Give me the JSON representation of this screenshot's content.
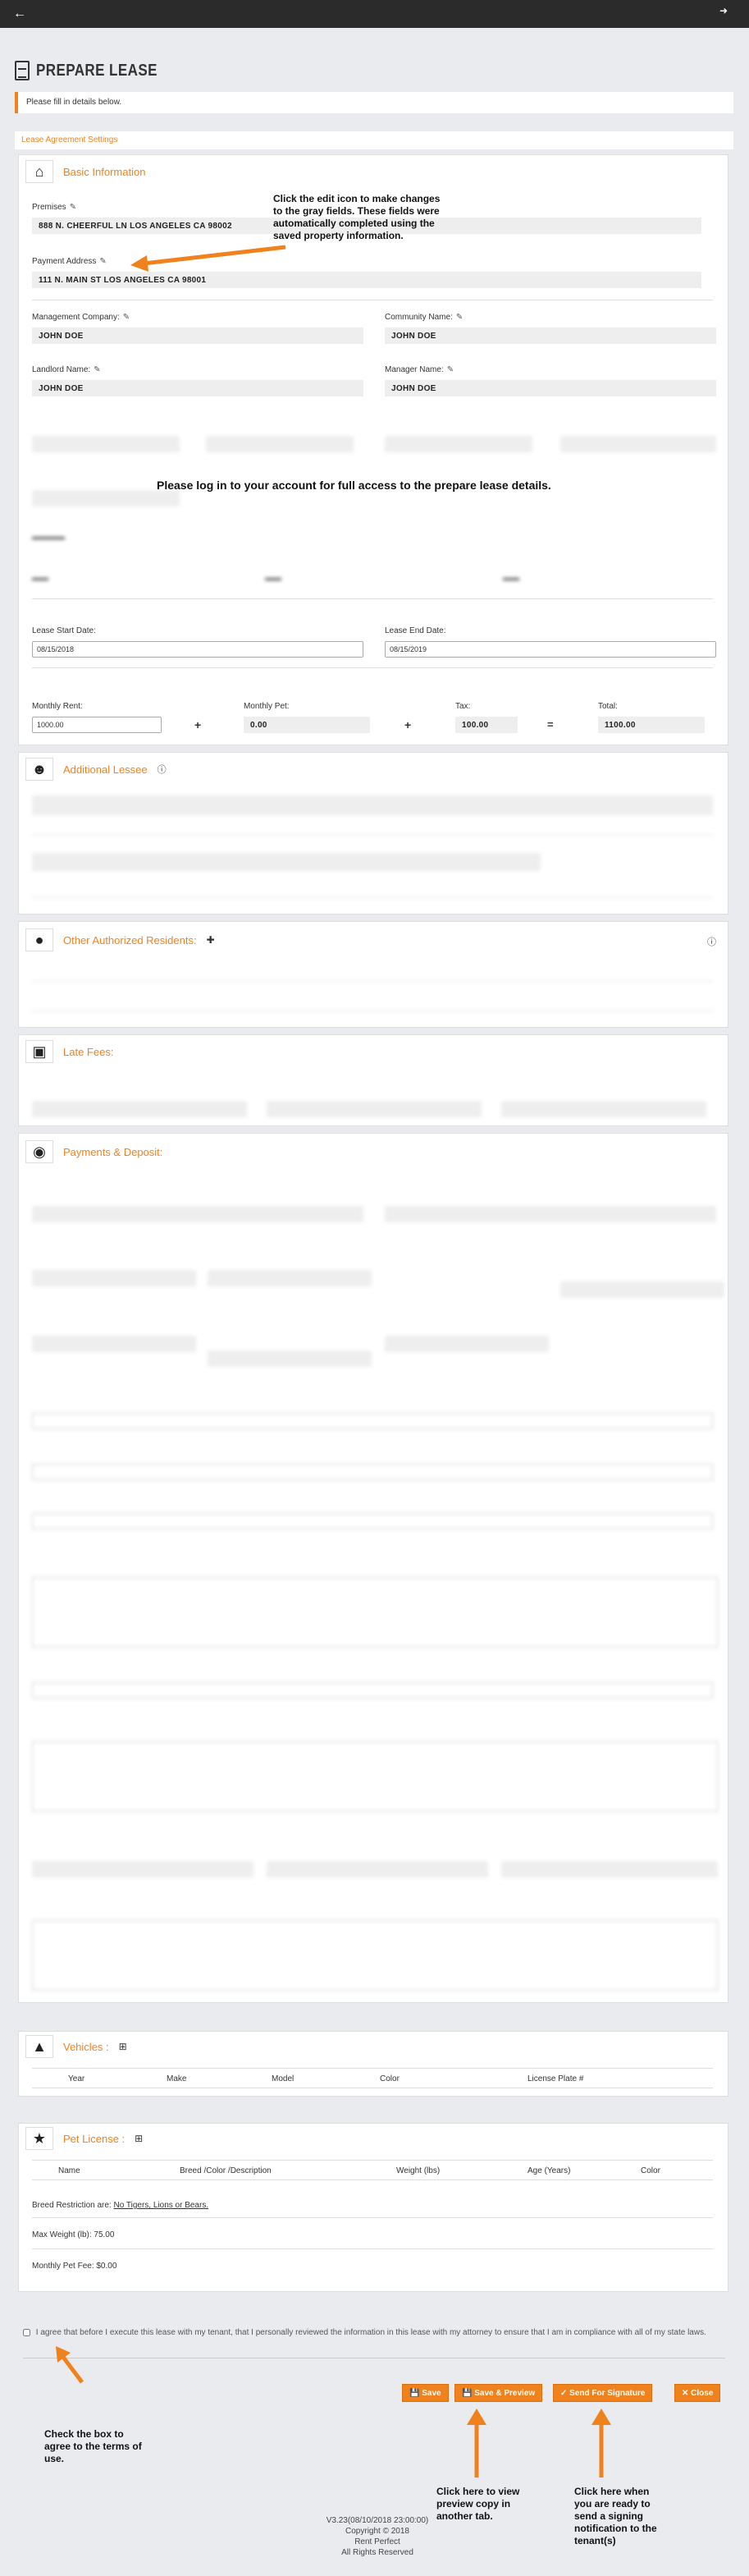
{
  "topbar": {
    "back_icon": "arrow-left-icon",
    "logout_icon": "sign-out-icon"
  },
  "page": {
    "title": "PREPARE LEASE"
  },
  "notice": "Please fill in details below.",
  "settings_bar": "Lease Agreement Settings",
  "basic": {
    "title": "Basic Information",
    "premises_label": "Premises",
    "premises_value": "888 N. CHEERFUL LN LOS ANGELES CA 98002",
    "payment_label": "Payment Address",
    "payment_value": "111 N. MAIN ST LOS ANGELES CA 98001",
    "mgmt_label": "Management Company:",
    "mgmt_value": "JOHN DOE",
    "community_label": "Community Name:",
    "community_value": "JOHN DOE",
    "landlord_label": "Landlord Name:",
    "landlord_value": "JOHN DOE",
    "manager_label": "Manager Name:",
    "manager_value": "JOHN DOE",
    "overlay_message": "Please log in to your account for full access to the prepare lease details.",
    "annotation": "Click the edit icon to make changes to the gray fields. These fields were automatically completed using the saved property information.",
    "start_label": "Lease Start Date:",
    "start_value": "08/15/2018",
    "end_label": "Lease End Date:",
    "end_value": "08/15/2019",
    "rent_label": "Monthly Rent:",
    "rent_value": "1000.00",
    "pet_label": "Monthly Pet:",
    "pet_value": "0.00",
    "tax_label": "Tax:",
    "tax_value": "100.00",
    "total_label": "Total:",
    "total_value": "1100.00",
    "plus": "+",
    "equals": "="
  },
  "additional_lessee": {
    "title": "Additional Lessee"
  },
  "other_residents": {
    "title": "Other Authorized Residents:"
  },
  "late_fees": {
    "title": "Late Fees:"
  },
  "payments": {
    "title": "Payments & Deposit:"
  },
  "vehicles": {
    "title": "Vehicles :",
    "columns": [
      "Year",
      "Make",
      "Model",
      "Color",
      "License Plate #"
    ]
  },
  "pet_license": {
    "title": "Pet License :",
    "columns": [
      "Name",
      "Breed /Color /Description",
      "Weight (lbs)",
      "Age (Years)",
      "Color"
    ],
    "breed_prefix": "Breed Restriction are:",
    "breed_value": "No Tigers, Lions or Bears.",
    "max_weight": "Max Weight (lb): 75.00",
    "monthly_fee": "Monthly Pet Fee: $0.00"
  },
  "agreement": {
    "text": "I agree that before I execute this lease with my tenant, that I personally reviewed the information in this lease with my attorney to ensure that I am in compliance with all of my state laws.",
    "annotation": "Check the box to agree to the terms of use."
  },
  "buttons": {
    "save": "Save",
    "save_preview": "Save & Preview",
    "send": "Send For Signature",
    "close": "Close"
  },
  "annotations": {
    "preview": "Click here to view preview copy in another tab.",
    "send": "Click here when you are ready to send a signing notification to the tenant(s)"
  },
  "footer": {
    "version": "V3.23(08/10/2018 23:00:00)",
    "copyright": "Copyright © 2018",
    "company": "Rent Perfect",
    "rights": "All Rights Reserved"
  },
  "colors": {
    "accent": "#f0821e",
    "topbar": "#2b2b2b",
    "background": "#e9ebee"
  }
}
